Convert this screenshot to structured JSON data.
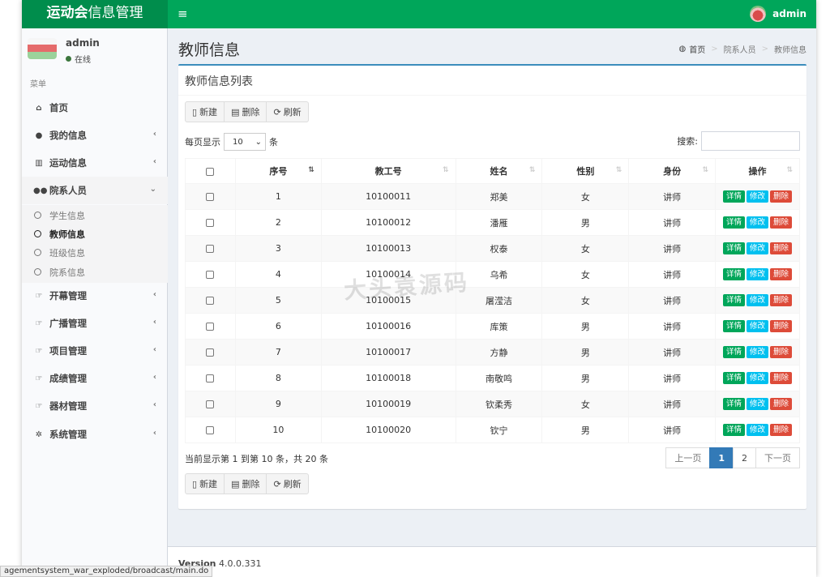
{
  "header": {
    "brand_bold": "运动会",
    "brand_rest": "信息管理",
    "toggle_icon": "≡",
    "user": "admin"
  },
  "sidebar": {
    "user_name": "admin",
    "user_status": "在线",
    "menu_header": "菜单",
    "items": [
      {
        "label": "首页",
        "icon": "home-icon",
        "glyph": "⌂",
        "has_arrow": false
      },
      {
        "label": "我的信息",
        "icon": "user-icon",
        "glyph": "●",
        "has_arrow": true
      },
      {
        "label": "运动信息",
        "icon": "chart-icon",
        "glyph": "▥",
        "has_arrow": true
      },
      {
        "label": "院系人员",
        "icon": "users-icon",
        "glyph": "●●",
        "has_arrow": true,
        "open": true
      },
      {
        "label": "开幕管理",
        "icon": "hand-icon",
        "glyph": "☞",
        "has_arrow": true
      },
      {
        "label": "广播管理",
        "icon": "hand-icon",
        "glyph": "☞",
        "has_arrow": true
      },
      {
        "label": "项目管理",
        "icon": "hand-icon",
        "glyph": "☞",
        "has_arrow": true
      },
      {
        "label": "成绩管理",
        "icon": "hand-icon",
        "glyph": "☞",
        "has_arrow": true
      },
      {
        "label": "器材管理",
        "icon": "hand-icon",
        "glyph": "☞",
        "has_arrow": true
      },
      {
        "label": "系统管理",
        "icon": "gear-icon",
        "glyph": "✲",
        "has_arrow": true
      }
    ],
    "sub_items": [
      {
        "label": "学生信息",
        "active": false
      },
      {
        "label": "教师信息",
        "active": true
      },
      {
        "label": "班级信息",
        "active": false
      },
      {
        "label": "院系信息",
        "active": false
      }
    ]
  },
  "page": {
    "title": "教师信息",
    "breadcrumb": [
      "首页",
      "院系人员",
      "教师信息"
    ]
  },
  "box": {
    "title": "教师信息列表",
    "buttons": [
      {
        "label": "新建",
        "icon": "file-icon",
        "glyph": "🗋"
      },
      {
        "label": "删除",
        "icon": "trash-icon",
        "glyph": "🗑"
      },
      {
        "label": "刷新",
        "icon": "refresh-icon",
        "glyph": "⟳"
      }
    ],
    "length_prefix": "每页显示",
    "length_value": "10",
    "length_suffix": "条",
    "search_label": "搜索:",
    "columns": [
      "序号",
      "教工号",
      "姓名",
      "性别",
      "身份",
      "操作"
    ],
    "rows": [
      [
        "1",
        "10100011",
        "郑美",
        "女",
        "讲师"
      ],
      [
        "2",
        "10100012",
        "潘雁",
        "男",
        "讲师"
      ],
      [
        "3",
        "10100013",
        "权泰",
        "女",
        "讲师"
      ],
      [
        "4",
        "10100014",
        "乌希",
        "女",
        "讲师"
      ],
      [
        "5",
        "10100015",
        "屠滢洁",
        "女",
        "讲师"
      ],
      [
        "6",
        "10100016",
        "库策",
        "男",
        "讲师"
      ],
      [
        "7",
        "10100017",
        "方静",
        "男",
        "讲师"
      ],
      [
        "8",
        "10100018",
        "南敬鸣",
        "男",
        "讲师"
      ],
      [
        "9",
        "10100019",
        "钦柔秀",
        "女",
        "讲师"
      ],
      [
        "10",
        "10100020",
        "钦宁",
        "男",
        "讲师"
      ]
    ],
    "actions": {
      "detail": "详情",
      "edit": "修改",
      "delete": "删除"
    },
    "info": "当前显示第 1 到第 10 条，共 20 条",
    "pager": {
      "prev": "上一页",
      "pages": [
        "1",
        "2"
      ],
      "active": "1",
      "next": "下一页"
    }
  },
  "watermark": "大头袁源码",
  "footer": {
    "version_label": "Version",
    "version_value": "4.0.0.331"
  },
  "statusbar": "agementsystem_war_exploded/broadcast/main.do",
  "colors": {
    "header": "#00a65a",
    "brand": "#008d4c",
    "accent": "#3c8dbc",
    "success": "#00a65a",
    "info": "#00c0ef",
    "danger": "#dd4b39"
  }
}
